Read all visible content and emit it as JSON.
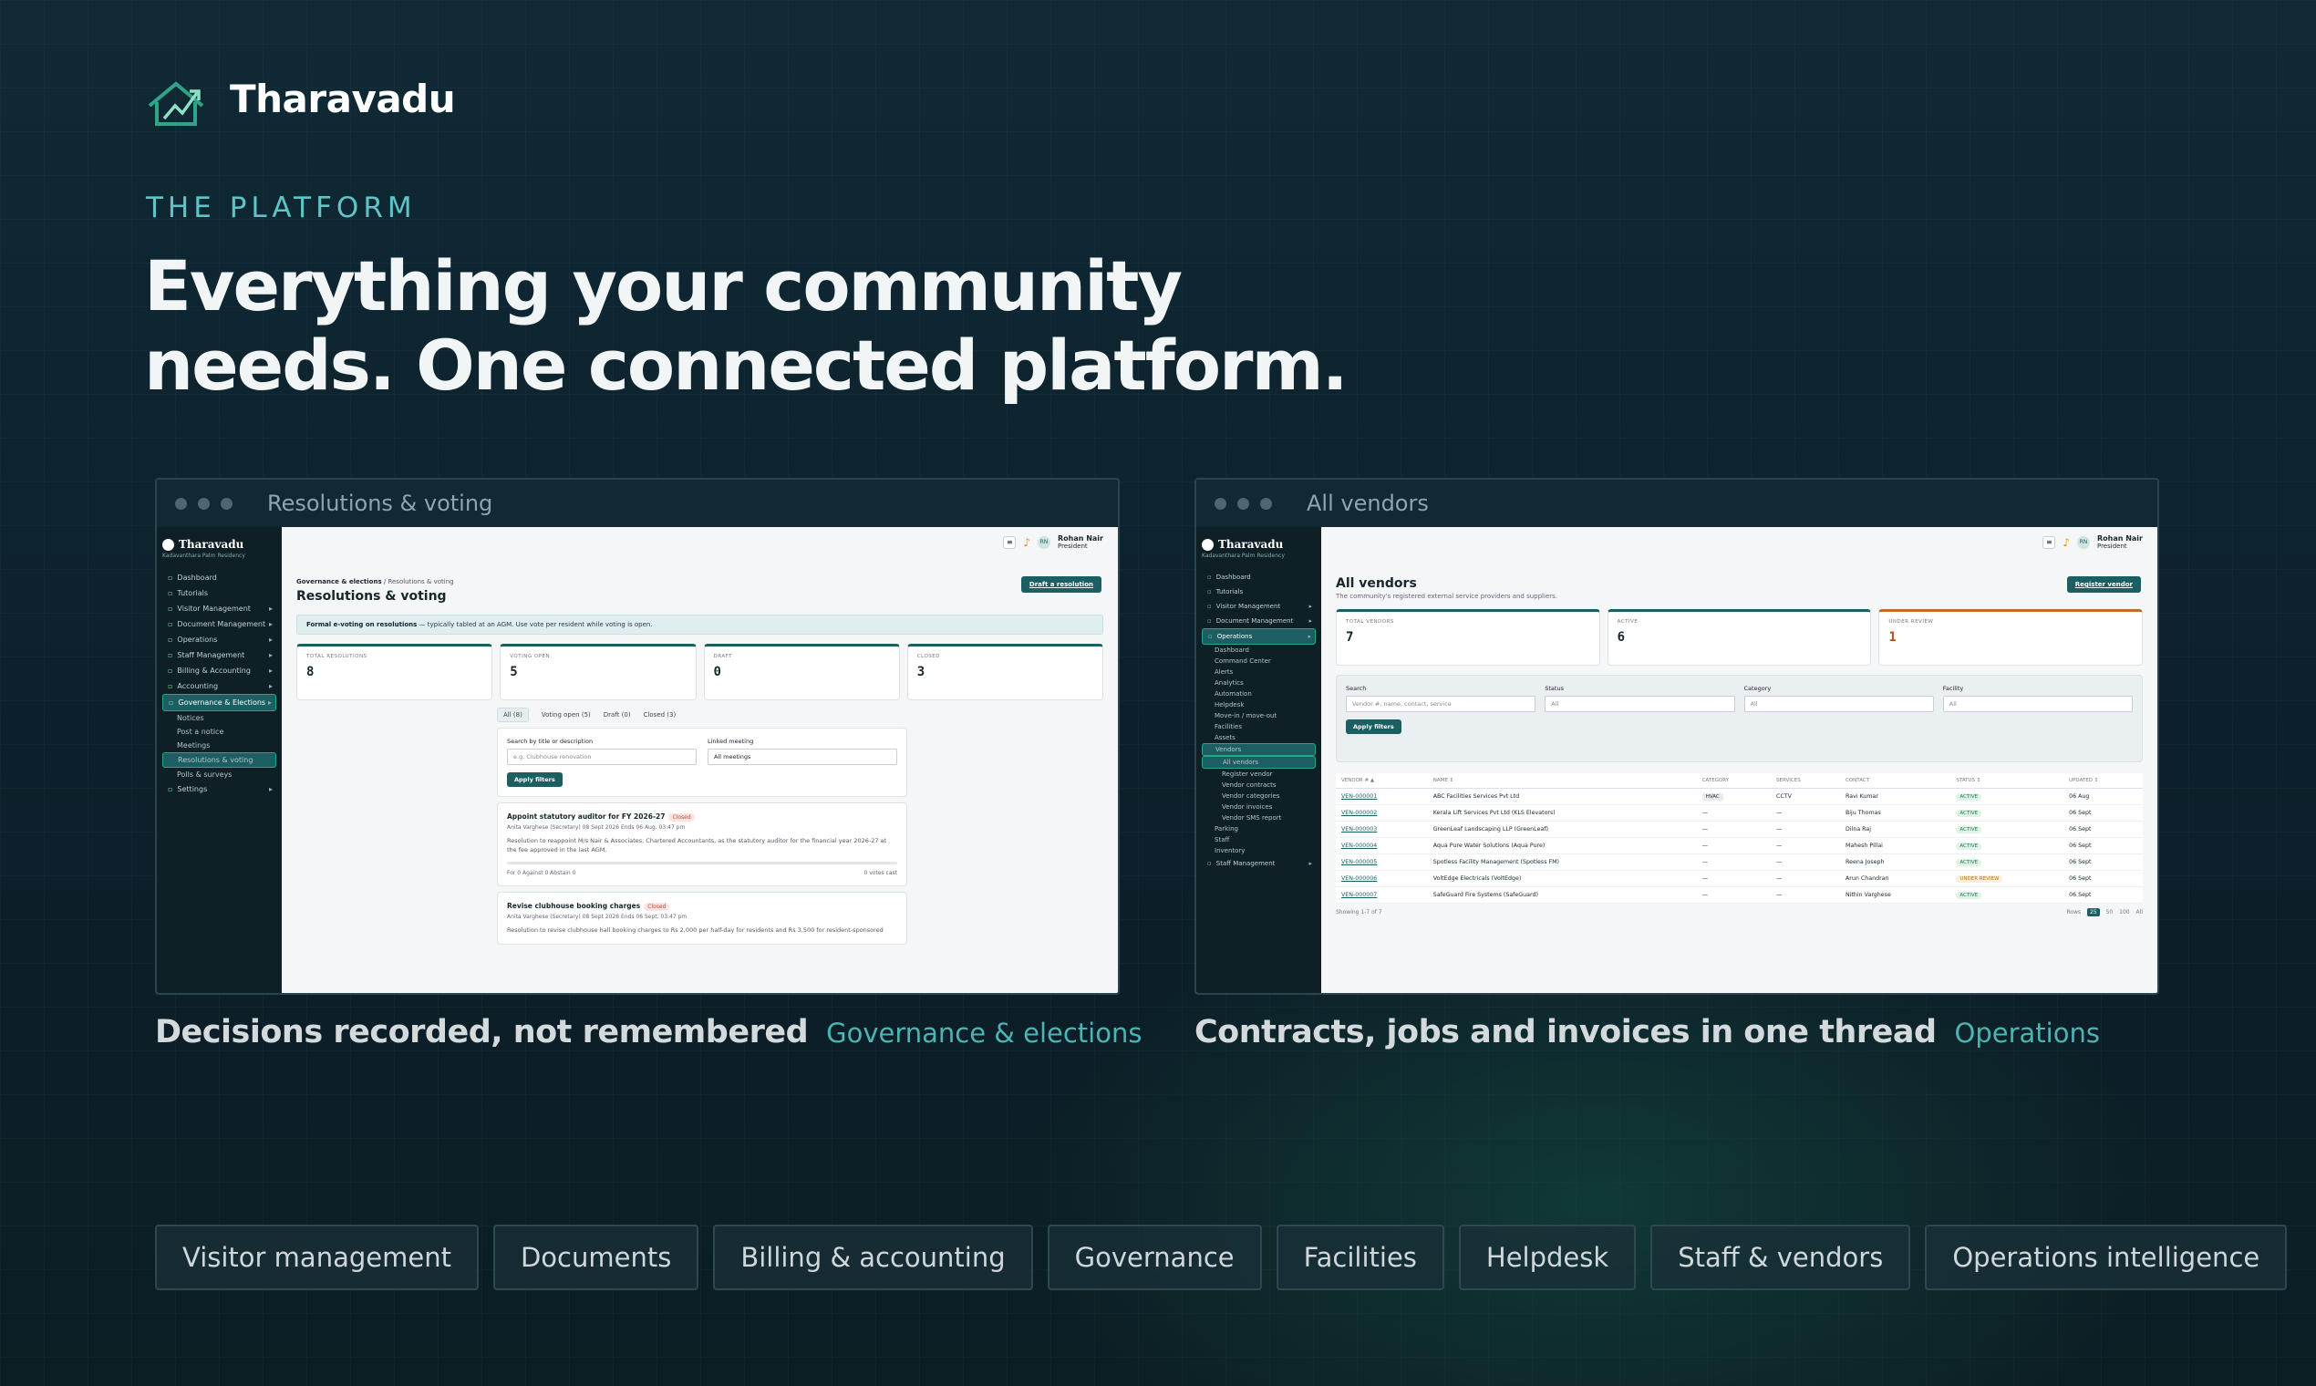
{
  "brand": {
    "name": "Tharavadu"
  },
  "hero": {
    "eyebrow": "THE PLATFORM",
    "headline": "Everything your community needs. One connected platform."
  },
  "shot1": {
    "window_title": "Resolutions & voting",
    "brand": "Tharavadu",
    "society": "Kadavanthara Palm Residency",
    "nav": [
      "Dashboard",
      "Tutorials",
      "Visitor Management",
      "Document Management",
      "Operations",
      "Staff Management",
      "Billing & Accounting",
      "Accounting",
      "Governance & Elections"
    ],
    "subnav": [
      "Notices",
      "Post a notice",
      "Meetings",
      "Resolutions & voting",
      "Polls & surveys"
    ],
    "settings": "Settings",
    "user": {
      "name": "Rohan Nair",
      "role": "President",
      "initials": "RN"
    },
    "breadcrumb_parent": "Governance & elections",
    "breadcrumb_current": "Resolutions & voting",
    "title": "Resolutions & voting",
    "primary_action": "Draft a resolution",
    "notice_strong": "Formal e-voting on resolutions",
    "notice_text": "— typically tabled at an AGM. Use vote per resident while voting is open.",
    "kpis": [
      {
        "label": "TOTAL RESOLUTIONS",
        "value": "8"
      },
      {
        "label": "VOTING OPEN",
        "value": "5"
      },
      {
        "label": "DRAFT",
        "value": "0"
      },
      {
        "label": "CLOSED",
        "value": "3"
      }
    ],
    "tabs": [
      "All (8)",
      "Voting open (5)",
      "Draft (0)",
      "Closed (3)"
    ],
    "search_label": "Search by title or description",
    "search_placeholder": "e.g. Clubhouse renovation",
    "meeting_label": "Linked meeting",
    "meeting_value": "All meetings",
    "apply": "Apply filters",
    "r1": {
      "title": "Appoint statutory auditor for FY 2026-27",
      "status": "Closed",
      "meta": "Anita Varghese (Secretary)   08 Sept 2026   Ends 06 Aug, 03:47 pm",
      "desc": "Resolution to reappoint M/s Nair & Associates, Chartered Accountants, as the statutory auditor for the financial year 2026-27 at the fee approved in the last AGM.",
      "votes": "For 0   Against 0   Abstain 0",
      "count": "0 votes cast"
    },
    "r2": {
      "title": "Revise clubhouse booking charges",
      "status": "Closed",
      "meta": "Anita Varghese (Secretary)   08 Sept 2026   Ends 06 Sept, 03:47 pm",
      "desc": "Resolution to revise clubhouse hall booking charges to Rs 2,000 per half-day for residents and Rs 3,500 for resident-sponsored"
    }
  },
  "shot2": {
    "window_title": "All vendors",
    "brand": "Tharavadu",
    "society": "Kadavanthara Palm Residency",
    "nav_top": [
      "Dashboard",
      "Tutorials",
      "Visitor Management",
      "Document Management",
      "Operations"
    ],
    "subnav": [
      "Dashboard",
      "Command Center",
      "Alerts",
      "Analytics",
      "Automation",
      "Helpdesk",
      "Move-in / move-out",
      "Facilities",
      "Assets",
      "Vendors",
      "All vendors",
      "Register vendor",
      "Vendor contracts",
      "Vendor categories",
      "Vendor invoices",
      "Vendor SMS report",
      "Parking",
      "Staff",
      "Inventory",
      "Staff Management"
    ],
    "user": {
      "name": "Rohan Nair",
      "role": "President",
      "initials": "RN"
    },
    "title": "All vendors",
    "subtitle": "The community's registered external service providers and suppliers.",
    "primary_action": "Register vendor",
    "kpis": [
      {
        "label": "TOTAL VENDORS",
        "value": "7"
      },
      {
        "label": "ACTIVE",
        "value": "6"
      },
      {
        "label": "UNDER REVIEW",
        "value": "1"
      }
    ],
    "filters": [
      {
        "label": "Search",
        "value": "Vendor #, name, contact, service"
      },
      {
        "label": "Status",
        "value": "All"
      },
      {
        "label": "Category",
        "value": "All"
      },
      {
        "label": "Facility",
        "value": "All"
      }
    ],
    "apply": "Apply filters",
    "columns": [
      "VENDOR # ▲",
      "NAME ↕",
      "CATEGORY",
      "SERVICES",
      "CONTACT",
      "STATUS ↕",
      "UPDATED ↕"
    ],
    "rows": [
      [
        "VEN-000001",
        "ABC Facilities Services Pvt Ltd",
        "HVAC",
        "CCTV",
        "Ravi Kumar",
        "ACTIVE",
        "06 Aug"
      ],
      [
        "VEN-000002",
        "Kerala Lift Services Pvt Ltd (KLS Elevators)",
        "—",
        "—",
        "Biju Thomas",
        "ACTIVE",
        "06 Sept"
      ],
      [
        "VEN-000003",
        "GreenLeaf Landscaping LLP (GreenLeaf)",
        "—",
        "—",
        "Dilna Raj",
        "ACTIVE",
        "06 Sept"
      ],
      [
        "VEN-000004",
        "Aqua Pure Water Solutions (Aqua Pure)",
        "—",
        "—",
        "Mahesh Pillai",
        "ACTIVE",
        "06 Sept"
      ],
      [
        "VEN-000005",
        "Spotless Facility Management (Spotless FM)",
        "—",
        "—",
        "Reena Joseph",
        "ACTIVE",
        "06 Sept"
      ],
      [
        "VEN-000006",
        "VoltEdge Electricals (VoltEdge)",
        "—",
        "—",
        "Arun Chandran",
        "UNDER REVIEW",
        "06 Sept"
      ],
      [
        "VEN-000007",
        "SafeGuard Fire Systems (SafeGuard)",
        "—",
        "—",
        "Nithin Varghese",
        "ACTIVE",
        "06 Sept"
      ]
    ],
    "showing": "Showing 1-7 of 7",
    "pager": [
      "Rows",
      "25",
      "50",
      "100",
      "All"
    ]
  },
  "captions": [
    {
      "title": "Decisions recorded, not remembered",
      "tag": "Governance & elections"
    },
    {
      "title": "Contracts, jobs and invoices in one thread",
      "tag": "Operations"
    }
  ],
  "chips": [
    "Visitor management",
    "Documents",
    "Billing & accounting",
    "Governance",
    "Facilities",
    "Helpdesk",
    "Staff & vendors",
    "Operations intelligence"
  ],
  "colors": {
    "accent": "#5ec4c6",
    "brand_dark": "#1c5f63",
    "background": "#0f2a35"
  }
}
